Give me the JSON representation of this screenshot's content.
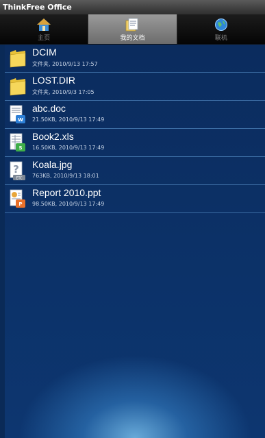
{
  "app": {
    "title": "ThinkFree Office"
  },
  "tabs": [
    {
      "label": "主页",
      "icon": "home-icon",
      "active": false
    },
    {
      "label": "我的文档",
      "icon": "documents-icon",
      "active": true
    },
    {
      "label": "联机",
      "icon": "globe-icon",
      "active": false
    }
  ],
  "files": [
    {
      "name": "DCIM",
      "meta": "文件夹, 2010/9/13 17:57",
      "icon": "folder-icon"
    },
    {
      "name": "LOST.DIR",
      "meta": "文件夹, 2010/9/3 17:05",
      "icon": "folder-icon"
    },
    {
      "name": "abc.doc",
      "meta": "21.50KB, 2010/9/13 17:49",
      "icon": "doc-file-icon"
    },
    {
      "name": "Book2.xls",
      "meta": "16.50KB, 2010/9/13 17:49",
      "icon": "xls-file-icon"
    },
    {
      "name": "Koala.jpg",
      "meta": "763KB, 2010/9/13 18:01",
      "icon": "unknown-file-icon",
      "icon_badge": "ETC"
    },
    {
      "name": "Report 2010.ppt",
      "meta": "98.50KB, 2010/9/13 17:49",
      "icon": "ppt-file-icon"
    }
  ]
}
